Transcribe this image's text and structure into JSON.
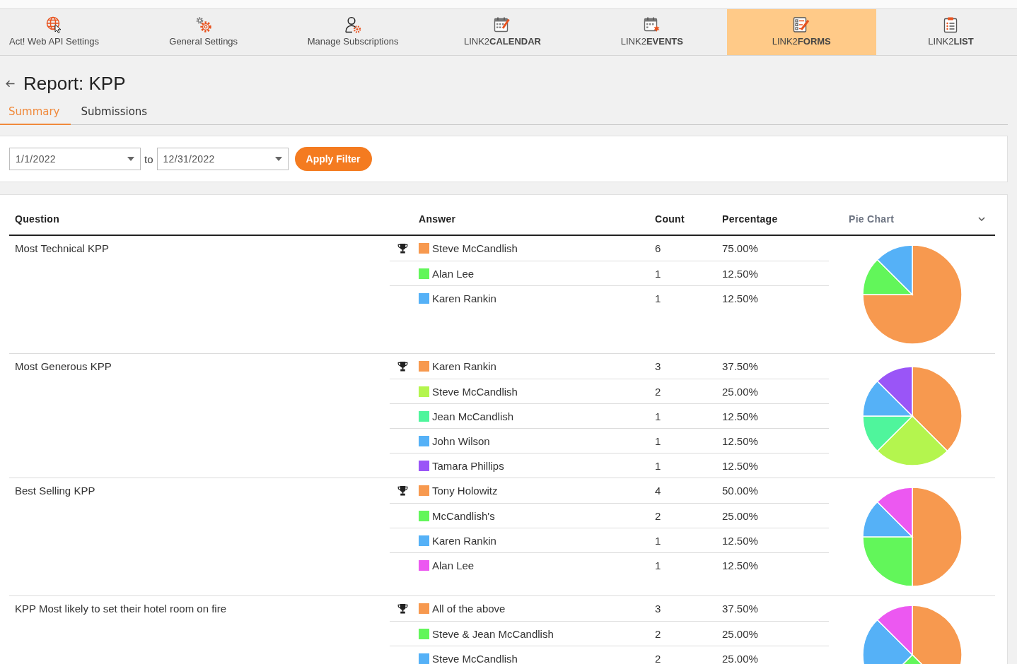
{
  "nav": {
    "items": [
      {
        "label": "Act! Web API Settings",
        "selected": false
      },
      {
        "label": "General Settings",
        "selected": false
      },
      {
        "label": "Manage Subscriptions",
        "selected": false
      },
      {
        "label": "LINK2**CALENDAR**",
        "selected": false
      },
      {
        "label": "LINK2**EVENTS**",
        "selected": false
      },
      {
        "label": "LINK2**FORMS**",
        "selected": true
      },
      {
        "label": "LINK2**LIST**",
        "selected": false
      }
    ]
  },
  "page": {
    "title": "Report: KPP"
  },
  "tabs": [
    {
      "label": "Summary",
      "selected": true
    },
    {
      "label": "Submissions",
      "selected": false
    }
  ],
  "filter": {
    "start_date": "1/1/2022",
    "joiner": "to",
    "end_date": "12/31/2022",
    "apply_button": "Apply Filter"
  },
  "table": {
    "columns": [
      "Question",
      "Answer",
      "Count",
      "Percentage"
    ],
    "chart_selector": "Pie Chart",
    "questions": [
      {
        "text": "Most Technical KPP",
        "answers": [
          {
            "name": "Steve McCandlish",
            "color": "#f7994f",
            "count": "6",
            "percentage": "75.00%",
            "winner": true
          },
          {
            "name": "Alan Lee",
            "color": "#62f65a",
            "count": "1",
            "percentage": "12.50%",
            "winner": false
          },
          {
            "name": "Karen Rankin",
            "color": "#55b1f7",
            "count": "1",
            "percentage": "12.50%",
            "winner": false
          }
        ],
        "chart_data": {
          "type": "pie",
          "values": [
            75,
            12.5,
            12.5
          ],
          "colors": [
            "#f7994f",
            "#62f65a",
            "#55b1f7"
          ]
        }
      },
      {
        "text": "Most Generous KPP",
        "answers": [
          {
            "name": "Karen Rankin",
            "color": "#f7994f",
            "count": "3",
            "percentage": "37.50%",
            "winner": true
          },
          {
            "name": "Steve McCandlish",
            "color": "#b4f54e",
            "count": "2",
            "percentage": "25.00%",
            "winner": false
          },
          {
            "name": "Jean McCandlish",
            "color": "#4ff59c",
            "count": "1",
            "percentage": "12.50%",
            "winner": false
          },
          {
            "name": "John Wilson",
            "color": "#55b1f7",
            "count": "1",
            "percentage": "12.50%",
            "winner": false
          },
          {
            "name": "Tamara Phillips",
            "color": "#9a55f7",
            "count": "1",
            "percentage": "12.50%",
            "winner": false
          }
        ],
        "chart_data": {
          "type": "pie",
          "values": [
            37.5,
            25,
            12.5,
            12.5,
            12.5
          ],
          "colors": [
            "#f7994f",
            "#b4f54e",
            "#4ff59c",
            "#55b1f7",
            "#9a55f7"
          ]
        }
      },
      {
        "text": "Best Selling KPP",
        "answers": [
          {
            "name": "Tony Holowitz",
            "color": "#f7994f",
            "count": "4",
            "percentage": "50.00%",
            "winner": true
          },
          {
            "name": "McCandlish's",
            "color": "#62f65a",
            "count": "2",
            "percentage": "25.00%",
            "winner": false
          },
          {
            "name": "Karen Rankin",
            "color": "#55b1f7",
            "count": "1",
            "percentage": "12.50%",
            "winner": false
          },
          {
            "name": "Alan Lee",
            "color": "#ec58f1",
            "count": "1",
            "percentage": "12.50%",
            "winner": false
          }
        ],
        "chart_data": {
          "type": "pie",
          "values": [
            50,
            25,
            12.5,
            12.5
          ],
          "colors": [
            "#f7994f",
            "#62f65a",
            "#55b1f7",
            "#ec58f1"
          ]
        }
      },
      {
        "text": "KPP Most likely to set their hotel room on fire",
        "answers": [
          {
            "name": "All of the above",
            "color": "#f7994f",
            "count": "3",
            "percentage": "37.50%",
            "winner": true
          },
          {
            "name": "Steve & Jean McCandlish",
            "color": "#62f65a",
            "count": "2",
            "percentage": "25.00%",
            "winner": false
          },
          {
            "name": "Steve McCandlish",
            "color": "#55b1f7",
            "count": "2",
            "percentage": "25.00%",
            "winner": false
          }
        ],
        "chart_data": {
          "type": "pie",
          "values": [
            37.5,
            25,
            25,
            12.5
          ],
          "colors": [
            "#f7994f",
            "#62f65a",
            "#55b1f7",
            "#ec58f1"
          ]
        }
      }
    ]
  }
}
